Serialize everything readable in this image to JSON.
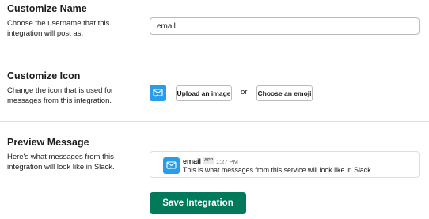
{
  "name_section": {
    "title": "Customize Name",
    "description": "Choose the username that this integration will post as.",
    "username_value": "email"
  },
  "icon_section": {
    "title": "Customize Icon",
    "description": "Change the icon that is used for messages from this integration.",
    "icon": "envelope-arrow-icon",
    "upload_label": "Upload an image",
    "or_label": "or",
    "emoji_label": "Choose an emoji"
  },
  "preview_section": {
    "title": "Preview Message",
    "description": "Here's what messages from this integration will look like in Slack.",
    "message": {
      "sender": "email",
      "badge": "APP",
      "time": "1:27 PM",
      "text": "This is what messages from this service will look like in Slack."
    }
  },
  "save_label": "Save Integration",
  "colors": {
    "icon_bg": "#2b9ce8",
    "save_bg": "#007a5a"
  }
}
